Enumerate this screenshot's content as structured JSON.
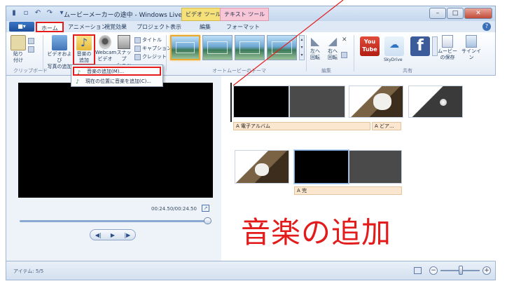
{
  "window": {
    "title": "ムービーメーカーの途中 - Windows Live ムービー ...",
    "tool_tab_video": "ビデオ ツール",
    "tool_tab_text": "テキスト ツール",
    "controls": [
      "–",
      "□",
      "✕"
    ]
  },
  "tabs": {
    "app_button": "■▾",
    "items": [
      "ホーム",
      "アニメーション",
      "視覚効果",
      "プロジェクト",
      "表示",
      "編集",
      "フォーマット"
    ],
    "help": "?"
  },
  "ribbon": {
    "paste_label": "貼り\n付け",
    "clipboard_group": "クリップボード",
    "add_video_label": "ビデオおよび\n写真の追加",
    "add_music_label": "音楽の\n追加",
    "webcam_label": "Webcam\nビデオ",
    "snapshot_label": "スナップ\nショット",
    "title_label": "タイトル",
    "caption_label": "キャプション",
    "credit_label": "クレジット",
    "theme_group": "オートムービーのテーマ",
    "rotate_left_label": "左へ\n回転",
    "rotate_right_label": "右へ\n回転",
    "edit_group": "編集",
    "youtube_label": "You\nTube",
    "skydrive_label": "SkyDrive",
    "facebook_label": "f",
    "save_movie_label": "ムービー\nの保存",
    "signin_label": "サインイン",
    "share_group": "共有"
  },
  "menu": {
    "add_music": "音楽の追加(M)...",
    "add_music_at_position": "現在の位置に音楽を追加(C)..."
  },
  "player": {
    "time": "00:24.50/00:24.50",
    "prev": "◀|",
    "play": "▶",
    "next": "|▶"
  },
  "storyboard": {
    "caption1": "A 電子アルバム",
    "caption2": "A どア...",
    "caption3": "A 完"
  },
  "annotation": {
    "text": "音楽の追加"
  },
  "status": {
    "items": "アイテム: 5/5"
  },
  "colors": {
    "highlight": "#e31b1b",
    "ribbon_blue": "#1c4d9a"
  }
}
